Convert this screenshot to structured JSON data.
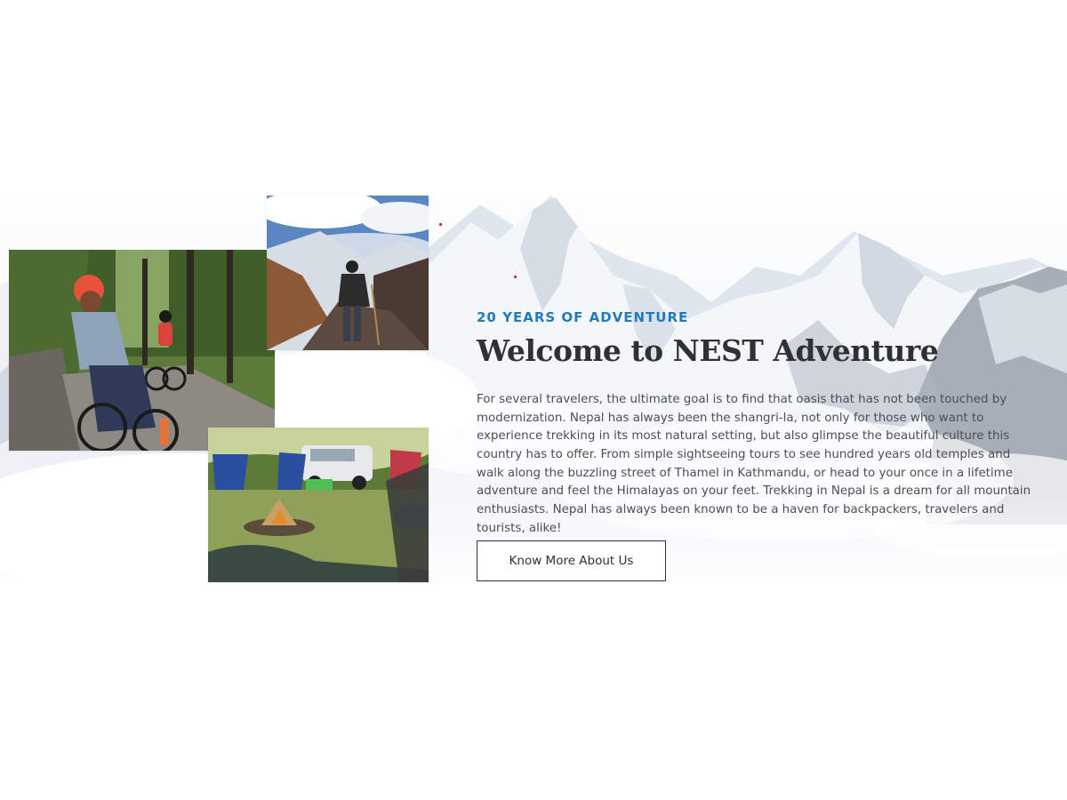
{
  "about": {
    "eyebrow": "20 YEARS OF ADVENTURE",
    "title": "Welcome to NEST Adventure",
    "description": "For several travelers, the ultimate goal is to find that oasis that has not been touched by modernization. Nepal has always been the shangri-la, not only for those who want to experience trekking in its most natural setting, but also glimpse the beautiful culture this country has to offer. From simple sightseeing tours to see hundred years old temples and walk along the buzzling street of Thamel in Kathmandu, or head to your once in a lifetime adventure and feel the Himalayas on your feet. Trekking in Nepal is a dream for all mountain enthusiasts. Nepal has always been known to be a haven for backpackers, travelers and tourists, alike!",
    "cta_label": "Know More About Us"
  },
  "colors": {
    "accent": "#1f7ac0",
    "heading": "#2e3233",
    "body": "#4a4f52",
    "marker": "#d0121b"
  }
}
